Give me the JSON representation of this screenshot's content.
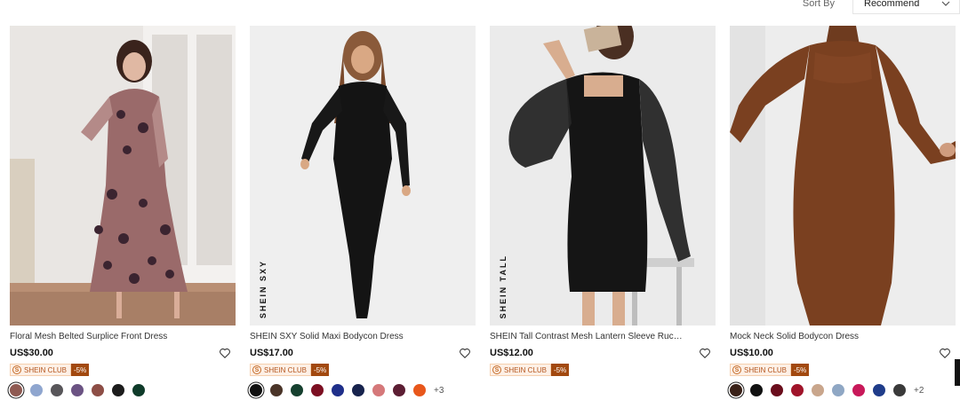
{
  "sort": {
    "label": "Sort By",
    "value": "Recommend"
  },
  "products": [
    {
      "title": "Floral Mesh Belted Surplice Front Dress",
      "price": "US$30.00",
      "club": "SHEIN CLUB",
      "discount": "-5%",
      "brand_mark": "",
      "image": "model in long-sleeve mauve floral mesh maxi dress",
      "swatches": [
        "#8f5a52",
        "#8fa6cf",
        "#58565a",
        "#6b5383",
        "#8d4e46",
        "#1c1c1c",
        "#0f3b2a"
      ],
      "selected_swatch": 0,
      "more": ""
    },
    {
      "title": "SHEIN SXY Solid Maxi Bodycon Dress",
      "price": "US$17.00",
      "club": "SHEIN CLUB",
      "discount": "-5%",
      "brand_mark": "SHEIN SXY",
      "image": "model in black long-sleeve maxi bodycon dress",
      "swatches": [
        "#111111",
        "#4a3428",
        "#16402f",
        "#7c0f22",
        "#1f2f8a",
        "#17234d",
        "#d5787a",
        "#5c1e33",
        "#e8571b"
      ],
      "selected_swatch": 0,
      "more": "+3"
    },
    {
      "title": "SHEIN Tall Contrast Mesh Lantern Sleeve Ruched Bodycon Dress",
      "price": "US$12.00",
      "club": "SHEIN CLUB",
      "discount": "-5%",
      "brand_mark": "SHEIN TALL",
      "image": "model in black ruched mini dress with sheer lantern sleeves",
      "swatches": [],
      "selected_swatch": -1,
      "more": ""
    },
    {
      "title": "Mock Neck Solid Bodycon Dress",
      "price": "US$10.00",
      "club": "SHEIN CLUB",
      "discount": "-5%",
      "brand_mark": "",
      "image": "model in brown mock neck bodycon mini dress",
      "swatches": [
        "#3a2118",
        "#111111",
        "#6a0d1c",
        "#a0142a",
        "#c9a68c",
        "#8fa7c4",
        "#c8195a",
        "#1f3c8a",
        "#3a3a3a"
      ],
      "selected_swatch": 0,
      "more": "+2"
    }
  ],
  "colors": {
    "club_bg": "#fdf0e6",
    "club_text": "#b4541d",
    "discount_bg": "#a2490f"
  }
}
